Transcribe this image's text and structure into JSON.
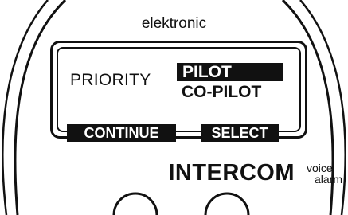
{
  "brand": {
    "text": "elektronic"
  },
  "screen": {
    "label": "PRIORITY",
    "options": [
      "PILOT",
      "CO-PILOT"
    ],
    "selected_option": "PILOT"
  },
  "softkeys": {
    "left": "CONTINUE",
    "right": "SELECT"
  },
  "product": {
    "name": "INTERCOM",
    "sub_line1": "voice",
    "sub_line2": "alarm"
  },
  "colors": {
    "ink": "#111111",
    "background": "#ffffff",
    "highlight_text": "#ffffff"
  }
}
